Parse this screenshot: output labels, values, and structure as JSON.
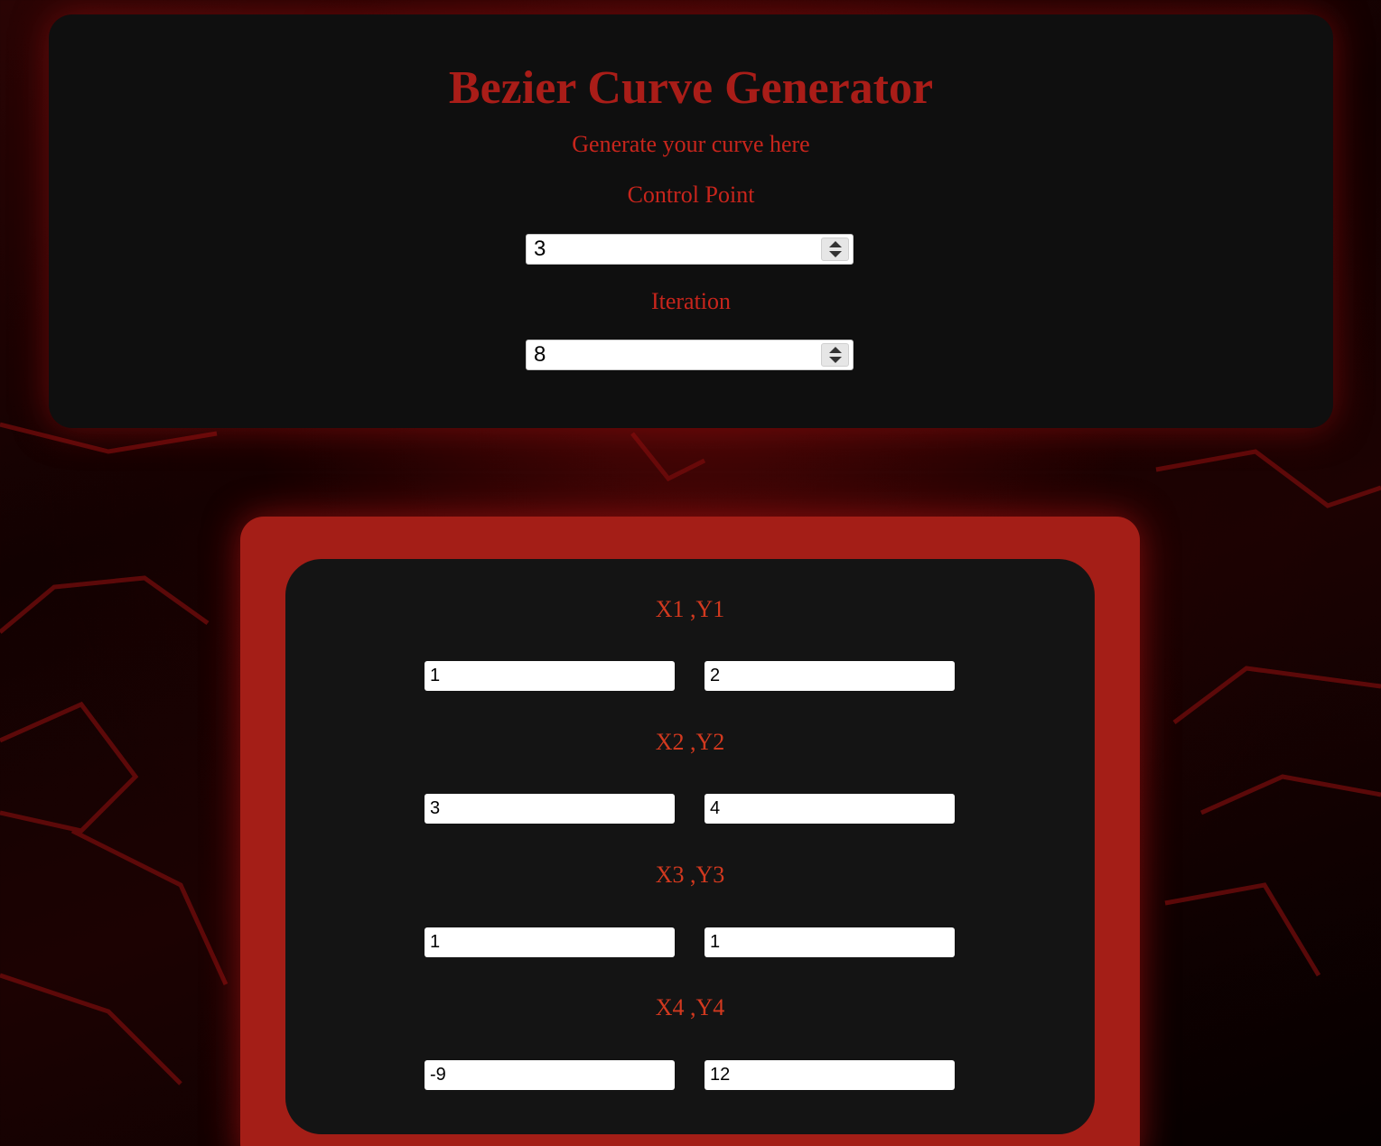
{
  "header": {
    "title": "Bezier Curve Generator",
    "subtitle": "Generate your curve here"
  },
  "settings": {
    "control_point": {
      "label": "Control Point",
      "value": "3"
    },
    "iteration": {
      "label": "Iteration",
      "value": "8"
    }
  },
  "points": [
    {
      "label": "X1 ,Y1",
      "x": "1",
      "y": "2"
    },
    {
      "label": "X2 ,Y2",
      "x": "3",
      "y": "4"
    },
    {
      "label": "X3 ,Y3",
      "x": "1",
      "y": "1"
    },
    {
      "label": "X4 ,Y4",
      "x": "-9",
      "y": "12"
    }
  ],
  "colors": {
    "accent_red": "#a91d18",
    "frame_red": "#a41e17",
    "panel_dark": "#0f0f0f",
    "label_orange_red": "#d2391f"
  }
}
